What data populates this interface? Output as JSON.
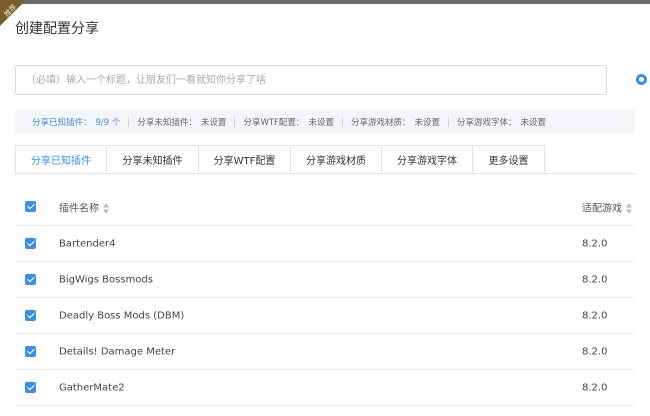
{
  "header": {
    "ribbon_text": "推荐",
    "title": "创建配置分享"
  },
  "title_input": {
    "placeholder": "（必填）输入一个标题，让朋友们一看就知你分享了啥",
    "value": ""
  },
  "summary": [
    {
      "label": "分享已知插件：",
      "value": "9/9 个",
      "active": true
    },
    {
      "label": "分享未知插件：",
      "value": "未设置",
      "active": false
    },
    {
      "label": "分享WTF配置：",
      "value": "未设置",
      "active": false
    },
    {
      "label": "分享游戏材质：",
      "value": "未设置",
      "active": false
    },
    {
      "label": "分享游戏字体：",
      "value": "未设置",
      "active": false
    }
  ],
  "tabs": [
    {
      "label": "分享已知插件",
      "active": true
    },
    {
      "label": "分享未知插件",
      "active": false
    },
    {
      "label": "分享WTF配置",
      "active": false
    },
    {
      "label": "分享游戏材质",
      "active": false
    },
    {
      "label": "分享游戏字体",
      "active": false
    },
    {
      "label": "更多设置",
      "active": false
    }
  ],
  "table": {
    "columns": {
      "name": "插件名称",
      "game": "适配游戏"
    },
    "header_checked": true,
    "rows": [
      {
        "name": "Bartender4",
        "game": "8.2.0",
        "checked": true
      },
      {
        "name": "BigWigs Bossmods",
        "game": "8.2.0",
        "checked": true
      },
      {
        "name": "Deadly Boss Mods (DBM)",
        "game": "8.2.0",
        "checked": true
      },
      {
        "name": "Details! Damage Meter",
        "game": "8.2.0",
        "checked": true
      },
      {
        "name": "GatherMate2",
        "game": "8.2.0",
        "checked": true
      }
    ]
  },
  "colors": {
    "accent": "#3d8fe0",
    "ribbon": "#7a5b2b"
  }
}
